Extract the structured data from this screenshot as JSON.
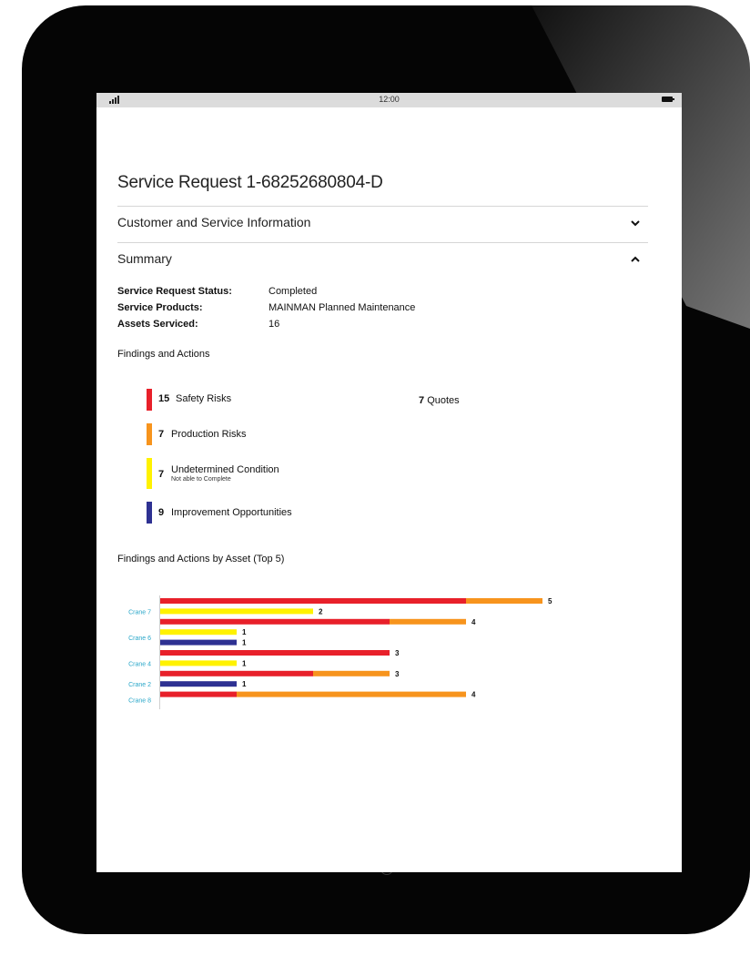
{
  "status_bar": {
    "signal_icon": "signal-icon",
    "time": "12:00",
    "battery_icon": "battery-icon"
  },
  "page_title": "Service Request 1-68252680804-D",
  "sections": {
    "customer": {
      "label": "Customer and Service Information",
      "icon": "chevron-down-icon"
    },
    "summary": {
      "label": "Summary",
      "icon": "chevron-up-icon"
    }
  },
  "summary_fields": [
    {
      "key": "Service Request Status:",
      "value": "Completed"
    },
    {
      "key": "Service Products:",
      "value": "MAINMAN Planned Maintenance"
    },
    {
      "key": "Assets Serviced:",
      "value": "16"
    }
  ],
  "findings_heading": "Findings and Actions",
  "findings": [
    {
      "count": "15",
      "label": "Safety Risks",
      "sublabel": "",
      "color": "#e8202a"
    },
    {
      "count": "7",
      "label": "Production Risks",
      "sublabel": "",
      "color": "#f7941d"
    },
    {
      "count": "7",
      "label": "Undetermined Condition",
      "sublabel": "Not able to Complete",
      "color": "#fff200"
    },
    {
      "count": "9",
      "label": "Improvement Opportunities",
      "sublabel": "",
      "color": "#2e3192"
    }
  ],
  "quotes": {
    "count": "7",
    "label": "Quotes"
  },
  "chart_heading": "Findings and Actions by Asset (Top 5)",
  "colors": {
    "safety": "#e8202a",
    "production": "#f7941d",
    "undetermined": "#fff200",
    "improvement": "#2e3192",
    "asset_label": "#2aa7c9"
  },
  "chart_data": {
    "type": "bar",
    "orientation": "horizontal",
    "title": "Findings and Actions by Asset (Top 5)",
    "stacked": true,
    "unit_scale_max": 5,
    "categories": [
      "Crane 7",
      "Crane 6",
      "Crane 4",
      "Crane 2",
      "Crane 8"
    ],
    "groups": [
      {
        "asset": "Crane 7",
        "rows": [
          {
            "segments": [
              {
                "series": "safety",
                "value": 4
              },
              {
                "series": "production",
                "value": 1
              }
            ],
            "total": 5
          },
          {
            "segments": [
              {
                "series": "undetermined",
                "value": 2
              }
            ],
            "total": 2
          }
        ]
      },
      {
        "asset": "Crane 6",
        "rows": [
          {
            "segments": [
              {
                "series": "safety",
                "value": 3
              },
              {
                "series": "production",
                "value": 1
              }
            ],
            "total": 4
          },
          {
            "segments": [
              {
                "series": "undetermined",
                "value": 1
              }
            ],
            "total": 1
          },
          {
            "segments": [
              {
                "series": "improvement",
                "value": 1
              }
            ],
            "total": 1
          }
        ]
      },
      {
        "asset": "Crane 4",
        "rows": [
          {
            "segments": [
              {
                "series": "safety",
                "value": 3
              }
            ],
            "total": 3
          },
          {
            "segments": [
              {
                "series": "undetermined",
                "value": 1
              }
            ],
            "total": 1
          }
        ]
      },
      {
        "asset": "Crane 2",
        "rows": [
          {
            "segments": [
              {
                "series": "safety",
                "value": 2
              },
              {
                "series": "production",
                "value": 1
              }
            ],
            "total": 3
          },
          {
            "segments": [
              {
                "series": "improvement",
                "value": 1
              }
            ],
            "total": 1
          }
        ]
      },
      {
        "asset": "Crane 8",
        "rows": [
          {
            "segments": [
              {
                "series": "safety",
                "value": 1
              },
              {
                "series": "production",
                "value": 3
              }
            ],
            "total": 4
          }
        ]
      }
    ]
  }
}
